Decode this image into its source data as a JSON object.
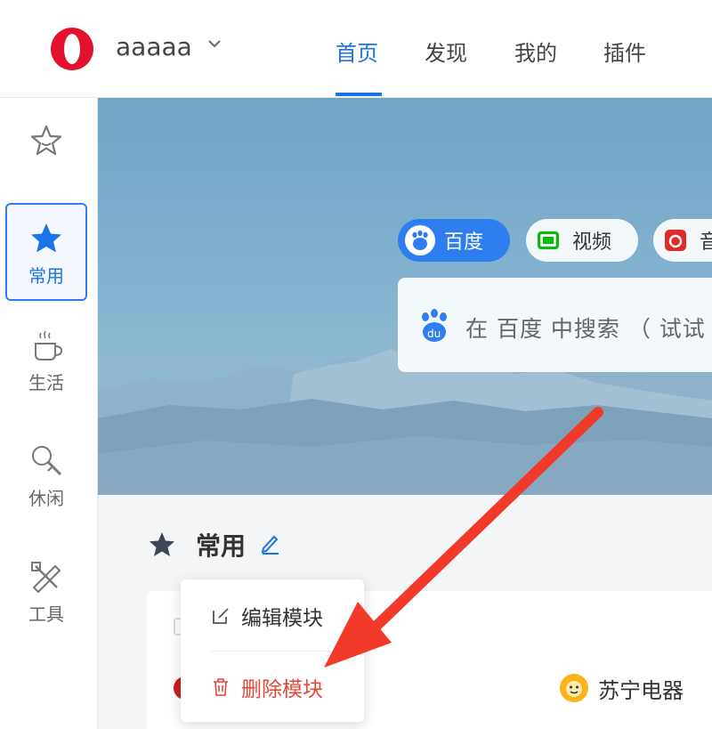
{
  "header": {
    "username": "aaaaa",
    "nav": [
      {
        "label": "首页",
        "active": true
      },
      {
        "label": "发现",
        "active": false
      },
      {
        "label": "我的",
        "active": false
      },
      {
        "label": "插件",
        "active": false
      }
    ]
  },
  "sidebar": {
    "items": [
      {
        "label": "",
        "icon": "star-outline-icon"
      },
      {
        "label": "常用",
        "icon": "star-filled-icon",
        "active": true
      },
      {
        "label": "生活",
        "icon": "coffee-cup-icon"
      },
      {
        "label": "休闲",
        "icon": "microphone-icon"
      },
      {
        "label": "工具",
        "icon": "tools-icon"
      }
    ]
  },
  "search": {
    "engines": [
      {
        "label": "百度",
        "icon": "baidu-icon",
        "active": true
      },
      {
        "label": "视频",
        "icon": "iqiyi-icon"
      },
      {
        "label": "音",
        "icon": "netease-music-icon"
      }
    ],
    "placeholder": "在 百度 中搜索 （ 试试"
  },
  "section": {
    "title": "常用"
  },
  "context_menu": {
    "edit_label": "编辑模块",
    "delete_label": "删除模块"
  },
  "sites": [
    {
      "label": "苏宁电器",
      "icon": "suning-icon"
    }
  ],
  "colors": {
    "accent": "#1a73e8",
    "danger": "#e4473a",
    "arrow": "#f23a2a"
  }
}
